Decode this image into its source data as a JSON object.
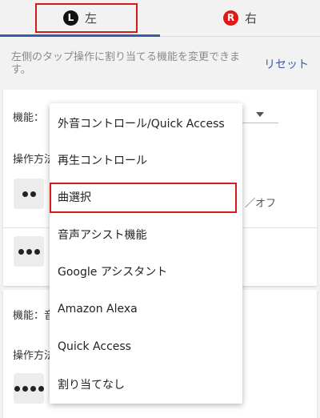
{
  "tabs": {
    "left": {
      "badge": "L",
      "label": "左"
    },
    "right": {
      "badge": "R",
      "label": "右"
    }
  },
  "description": "左側のタップ操作に割り当てる機能を変更できます。",
  "reset_label": "リセット",
  "card1": {
    "function_label": "機能：",
    "operation_label": "操作方法",
    "onoff_text": "／オフ"
  },
  "card2": {
    "function_label": "機能：音",
    "operation_label": "操作方法"
  },
  "menu": {
    "items": [
      "外音コントロール/Quick Access",
      "再生コントロール",
      "曲選択",
      "音声アシスト機能",
      "Google アシスタント",
      "Amazon Alexa",
      "Quick Access",
      "割り当てなし"
    ],
    "highlighted_index": 2
  },
  "colors": {
    "accent": "#3b5ba9",
    "highlight_border": "#d51a1a",
    "right_badge": "#e01818"
  }
}
